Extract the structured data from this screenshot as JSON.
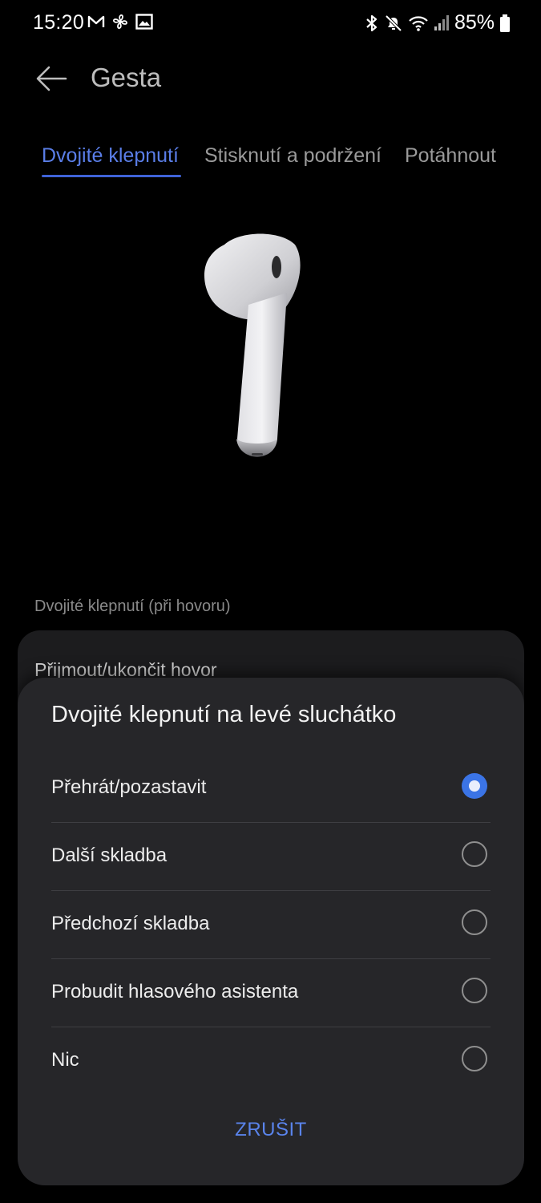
{
  "status_bar": {
    "time": "15:20",
    "battery": "85%",
    "left_icons": [
      "mail-icon",
      "fan-icon",
      "image-icon"
    ],
    "right_icons": [
      "bluetooth-icon",
      "mute-icon",
      "wifi-icon",
      "signal-icon",
      "battery-icon"
    ]
  },
  "header": {
    "title": "Gesta",
    "back_icon": "back-arrow-icon"
  },
  "tabs": [
    {
      "label": "Dvojité klepnutí",
      "active": true
    },
    {
      "label": "Stisknutí a podržení",
      "active": false
    },
    {
      "label": "Potáhnout",
      "active": false
    }
  ],
  "section": {
    "label": "Dvojité klepnutí (při hovoru)",
    "value": "Přijmout/ukončit hovor"
  },
  "dialog": {
    "title": "Dvojité klepnutí na levé sluchátko",
    "options": [
      {
        "label": "Přehrát/pozastavit",
        "selected": true
      },
      {
        "label": "Další skladba",
        "selected": false
      },
      {
        "label": "Předchozí skladba",
        "selected": false
      },
      {
        "label": "Probudit hlasového asistenta",
        "selected": false
      },
      {
        "label": "Nic",
        "selected": false
      }
    ],
    "cancel_label": "ZRUŠIT"
  },
  "colors": {
    "accent": "#3b74e6",
    "background": "#000000",
    "dialog_bg": "#262629"
  }
}
